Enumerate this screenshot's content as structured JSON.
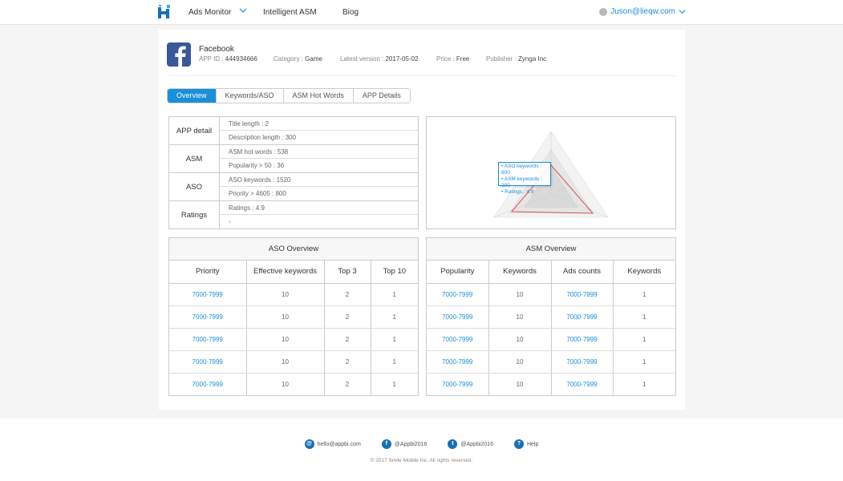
{
  "nav": {
    "ads_monitor": "Ads Monitor",
    "intelligent_asm": "Intelligent ASM",
    "blog": "Biog",
    "user_email": "Juson@lieqw.com"
  },
  "app": {
    "name": "Facebook",
    "app_id_label": "APP ID :",
    "app_id": "444934666",
    "category_label": "Category :",
    "category": "Game",
    "version_label": "Latest version :",
    "version": "2017-05-02",
    "price_label": "Price :",
    "price": "Free",
    "publisher_label": "Publisher :",
    "publisher": "Zynga Inc"
  },
  "tabs": [
    "Overview",
    "Keywords/ASO",
    "ASM Hot Words",
    "APP Details"
  ],
  "active_tab": "Overview",
  "details": {
    "app_detail": {
      "label": "APP detail",
      "rows": [
        "Title length  : 2",
        "Description length  : 300"
      ]
    },
    "asm": {
      "label": "ASM",
      "rows": [
        " ASM hot words : 538",
        "Popularity > 50 : 36"
      ]
    },
    "aso": {
      "label": "ASO",
      "rows": [
        "ASO keywords : 1520",
        "Priority > 4605 : 800"
      ]
    },
    "ratings": {
      "label": "Ratings",
      "rows": [
        "Ratings : 4.9",
        "-"
      ]
    }
  },
  "radar": {
    "tooltip": [
      "• ASO keywords : 800",
      "• ASM keywords : 200",
      "• Ratings : 4.9"
    ]
  },
  "aso_overview": {
    "title": "ASO Overview",
    "headers": [
      "Priority",
      "Effective keywords",
      "Top 3",
      "Top 10"
    ],
    "rows": [
      [
        "7000-7999",
        "10",
        "2",
        "1"
      ],
      [
        "7000-7999",
        "10",
        "2",
        "1"
      ],
      [
        "7000-7999",
        "10",
        "2",
        "1"
      ],
      [
        "7000-7999",
        "10",
        "2",
        "1"
      ],
      [
        "7000-7999",
        "10",
        "2",
        "1"
      ]
    ]
  },
  "asm_overview": {
    "title": "ASM Overview",
    "headers": [
      "Popularity",
      "Keywords",
      "Ads counts",
      "Keywords"
    ],
    "rows": [
      [
        "7000-7999",
        "10",
        "7000-7999",
        "1"
      ],
      [
        "7000-7999",
        "10",
        "7000-7999",
        "1"
      ],
      [
        "7000-7999",
        "10",
        "7000-7999",
        "1"
      ],
      [
        "7000-7999",
        "10",
        "7000-7999",
        "1"
      ],
      [
        "7000-7999",
        "10",
        "7000-7999",
        "1"
      ]
    ]
  },
  "footer": {
    "email": "hello@appbi.com",
    "facebook": "@Appbi2016",
    "twitter": "@Appbi2016",
    "help": "Help",
    "copyright": "© 2017 Smile Mobile Inc. All rights reserved."
  },
  "colors": {
    "accent": "#1a8fd8",
    "facebook": "#3b5998",
    "radar_line": "#d9534f"
  }
}
